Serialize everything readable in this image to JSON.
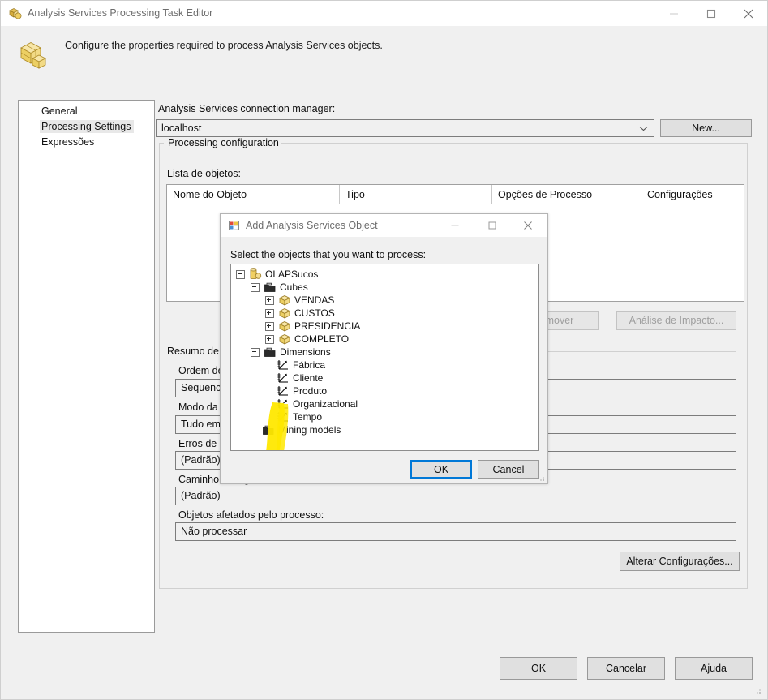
{
  "window": {
    "title": "Analysis Services Processing Task Editor",
    "icon": "cubes-icon",
    "minimize_label": "minimize-icon",
    "maximize_label": "maximize-icon",
    "close_label": "close-icon"
  },
  "header": {
    "icon": "cubes-icon",
    "description": "Configure the properties required to process Analysis Services objects."
  },
  "sidebar": {
    "items": [
      {
        "label": "General",
        "selected": false
      },
      {
        "label": "Processing Settings",
        "selected": true
      },
      {
        "label": "Expressões",
        "selected": false
      }
    ]
  },
  "main": {
    "connection_label": "Analysis Services connection manager:",
    "connection_value": "localhost",
    "new_button": "New...",
    "groupbox_legend": "Processing configuration",
    "object_list_label": "Lista de objetos:",
    "grid_columns": [
      "Nome do Objeto",
      "Tipo",
      "Opções de Processo",
      "Configurações"
    ],
    "grid_rows": [],
    "remove_button": "Remover",
    "impact_button": "Análise de Impacto...",
    "summary_legend": "Resumo de Configurações",
    "fields": [
      {
        "label": "Ordem de processamento:",
        "value": "Sequencial"
      },
      {
        "label": "Modo da transação:",
        "value": "Tudo em uma transação"
      },
      {
        "label": "Erros de chave de dimensão:",
        "value": "(Padrão)"
      },
      {
        "label": "Caminho do log de erros:",
        "value": "(Padrão)"
      },
      {
        "label": "Objetos afetados pelo processo:",
        "value": "Não processar"
      }
    ],
    "change_settings_button": "Alterar Configurações..."
  },
  "footer": {
    "ok": "OK",
    "cancel": "Cancelar",
    "help": "Ajuda"
  },
  "dialog": {
    "title": "Add Analysis Services Object",
    "icon": "objects-grid-icon",
    "instruction": "Select the objects that you want to process:",
    "ok": "OK",
    "cancel": "Cancel",
    "tree": [
      {
        "label": "OLAPSucos",
        "depth": 0,
        "toggle": "minus",
        "icon": "database-icon"
      },
      {
        "label": "Cubes",
        "depth": 1,
        "toggle": "minus",
        "icon": "folder-icon"
      },
      {
        "label": "VENDAS",
        "depth": 2,
        "toggle": "plus",
        "icon": "cube-icon"
      },
      {
        "label": "CUSTOS",
        "depth": 2,
        "toggle": "plus",
        "icon": "cube-icon"
      },
      {
        "label": "PRESIDENCIA",
        "depth": 2,
        "toggle": "plus",
        "icon": "cube-icon"
      },
      {
        "label": "COMPLETO",
        "depth": 2,
        "toggle": "plus",
        "icon": "cube-icon"
      },
      {
        "label": "Dimensions",
        "depth": 1,
        "toggle": "minus",
        "icon": "folder-icon"
      },
      {
        "label": "Fábrica",
        "depth": 2,
        "toggle": "none",
        "icon": "dimension-icon"
      },
      {
        "label": "Cliente",
        "depth": 2,
        "toggle": "none",
        "icon": "dimension-icon"
      },
      {
        "label": "Produto",
        "depth": 2,
        "toggle": "none",
        "icon": "dimension-icon"
      },
      {
        "label": "Organizacional",
        "depth": 2,
        "toggle": "none",
        "icon": "dimension-icon"
      },
      {
        "label": "Tempo",
        "depth": 2,
        "toggle": "none",
        "icon": "dimension-icon"
      },
      {
        "label": "Mining models",
        "depth": 1,
        "toggle": "none",
        "icon": "folder-icon"
      }
    ],
    "annotation": {
      "type": "highlighter-stroke",
      "color": "#ffe800"
    }
  },
  "colors": {
    "window_bg": "#f0f0f0",
    "titlebar_bg": "#ffffff",
    "focus_accent": "#0078d7",
    "highlight": "#ffe800",
    "field_border": "#7c7c7c"
  }
}
